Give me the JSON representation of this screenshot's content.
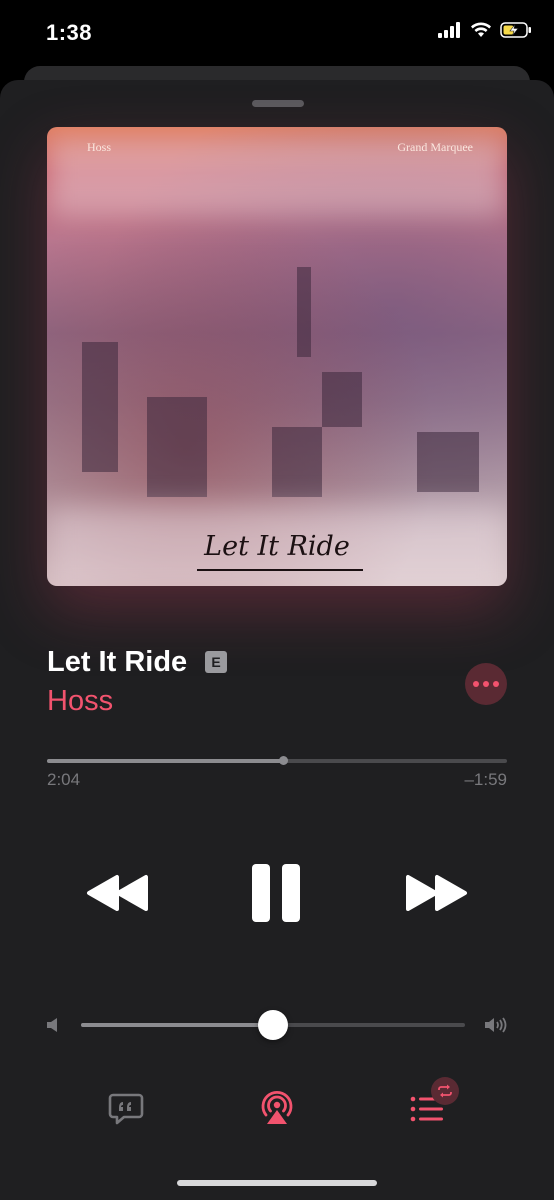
{
  "status_bar": {
    "time": "1:38",
    "icons": [
      "cellular-signal-icon",
      "wifi-icon",
      "battery-charging-icon"
    ]
  },
  "now_playing": {
    "artwork": {
      "artist_text": "Hoss",
      "album_text": "Grand Marquee",
      "title_text": "Let It Ride"
    },
    "title": "Let It Ride",
    "explicit_badge": "E",
    "artist": "Hoss",
    "progress": {
      "elapsed": "2:04",
      "remaining": "–1:59",
      "fraction": 0.512
    },
    "volume": {
      "fraction": 0.5
    },
    "controls": [
      "rewind-icon",
      "pause-icon",
      "fast-forward-icon"
    ],
    "bottom_bar": [
      "lyrics-icon",
      "airplay-icon",
      "queue-icon",
      "repeat-icon"
    ]
  },
  "colors": {
    "accent": "#f2536e",
    "sheet_background": "#1f1f21",
    "secondary_text": "#78787c"
  }
}
